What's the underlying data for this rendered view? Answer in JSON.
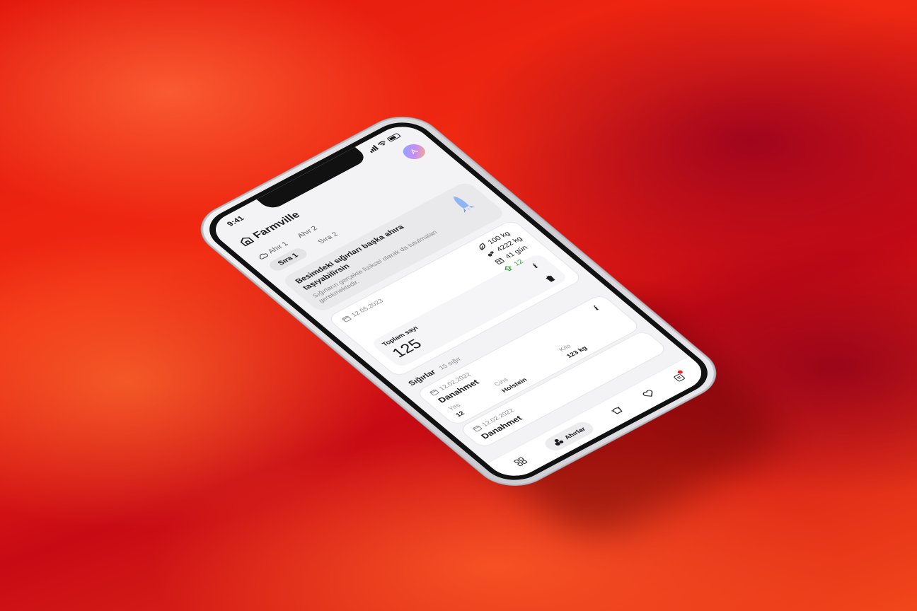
{
  "status": {
    "time": "9:41"
  },
  "app": {
    "title": "Farmville",
    "avatar_letter": "A"
  },
  "tabs": {
    "barns": [
      "Ahır 1",
      "Ahır 2"
    ],
    "rows": [
      "Sıra 1",
      "Sıra 2"
    ]
  },
  "banner": {
    "title": "Besimdeki sığırları başka ahıra taşıyabilirsin",
    "subtitle": "Sığırların gerçekte fiziksel olarak da tutulmaları gerekmektedir."
  },
  "summary": {
    "date": "12.05.2023",
    "stats": {
      "weight": "100 kg",
      "total_weight": "4222 kg",
      "days": "41 gün",
      "added": "12"
    },
    "total_label": "Toplam sayı",
    "total_value": "125"
  },
  "cattle_section": {
    "title": "Sığırlar",
    "count": "15 sığır"
  },
  "cattle": [
    {
      "date": "12.02.2022",
      "name": "Danahmet",
      "age_label": "Yaş",
      "age": "12",
      "breed_label": "Cins",
      "breed": "Holstein",
      "weight_label": "Kilo",
      "weight": "123 kg"
    },
    {
      "date": "12.02.2022",
      "name": "Danahmet"
    }
  ],
  "nav": {
    "active_label": "Ahırlar"
  },
  "colors": {
    "accent_green": "#2f9e3e",
    "badge_red": "#e22222",
    "background_red": "#e2150c"
  }
}
